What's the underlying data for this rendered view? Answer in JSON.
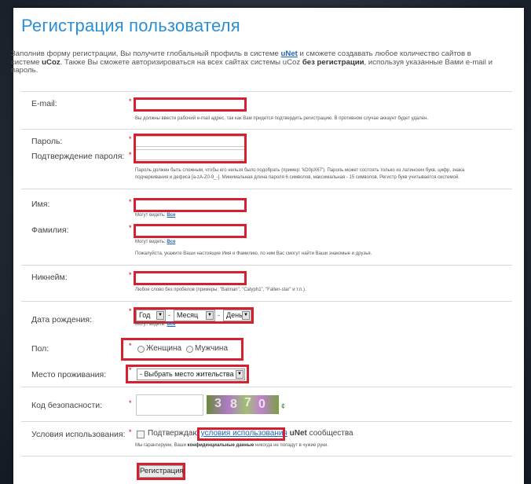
{
  "page": {
    "title": "Регистрация пользователя",
    "intro_1": "Заполнив форму регистрации, Вы получите глобальный профиль в системе ",
    "intro_unet": "uNet",
    "intro_2": " и сможете создавать любое количество сайтов в системе ",
    "intro_ucoz": "uCoz",
    "intro_3": ". Также Вы сможете авторизироваться на всех сайтах системы uCoz ",
    "intro_bold": "без регистрации",
    "intro_4": ", используя указанные Вами e-mail и пароль."
  },
  "form": {
    "email_label": "E-mail:",
    "email_hint": "Вы должны ввести рабочий e-mail адрес, так как Вам придется подтвердить регистрацию. В противном случае аккаунт будет удален.",
    "password_label": "Пароль:",
    "password_confirm_label": "Подтверждение пароля:",
    "password_hint_1": "Пароль должен быть сложным, чтобы его нельзя было подобрать (пример: 'kD0pX67'). Пароль может состоять только из латинских букв, цифр, знака",
    "password_hint_2": "подчеркивания и дефиса [a-zA-Z0-9_-]. Минимальная длина пароля 6 символов, максимальная - 15 символов. Регистр букв учитывается системой.",
    "first_name_label": "Имя:",
    "visible_to": "Могут видеть: ",
    "visible_all": "Все",
    "last_name_label": "Фамилия:",
    "name_hint": "Пожалуйста, укажите Ваши настоящие Имя и Фамилию, по ним Вас смогут найти Ваши знакомые и друзья.",
    "nickname_label": "Никнейм:",
    "nickname_hint": "Любое слово без пробелов (примеры: \"Batman\", \"Catyph1\", \"Fallen-star\" и т.п.).",
    "birth_label": "Дата рождения:",
    "year": "Год",
    "month": "Месяц",
    "day": "День",
    "dash": "-",
    "gender_label": "Пол:",
    "gender_female": "Женщина",
    "gender_male": "Мужчина",
    "location_label": "Место проживания:",
    "location_value": "- Выбрать место жительства -",
    "captcha_label": "Код безопасности:",
    "captcha_refresh": "¢",
    "terms_label": "Условия использования:",
    "terms_text": "Подтверждаю ",
    "terms_link": "условия использования",
    "terms_unet": " uNet",
    "terms_suffix": " сообщества",
    "privacy_hint_1": "Мы гарантируем, Ваши ",
    "privacy_hint_bold": "конфиденциальные данные",
    "privacy_hint_2": " никогда не попадут в чужие руки.",
    "submit": "Регистрация",
    "required_mark": "*"
  },
  "colors": {
    "title": "#2c8fd3",
    "highlight": "#d5202f",
    "link": "#2266bb"
  }
}
